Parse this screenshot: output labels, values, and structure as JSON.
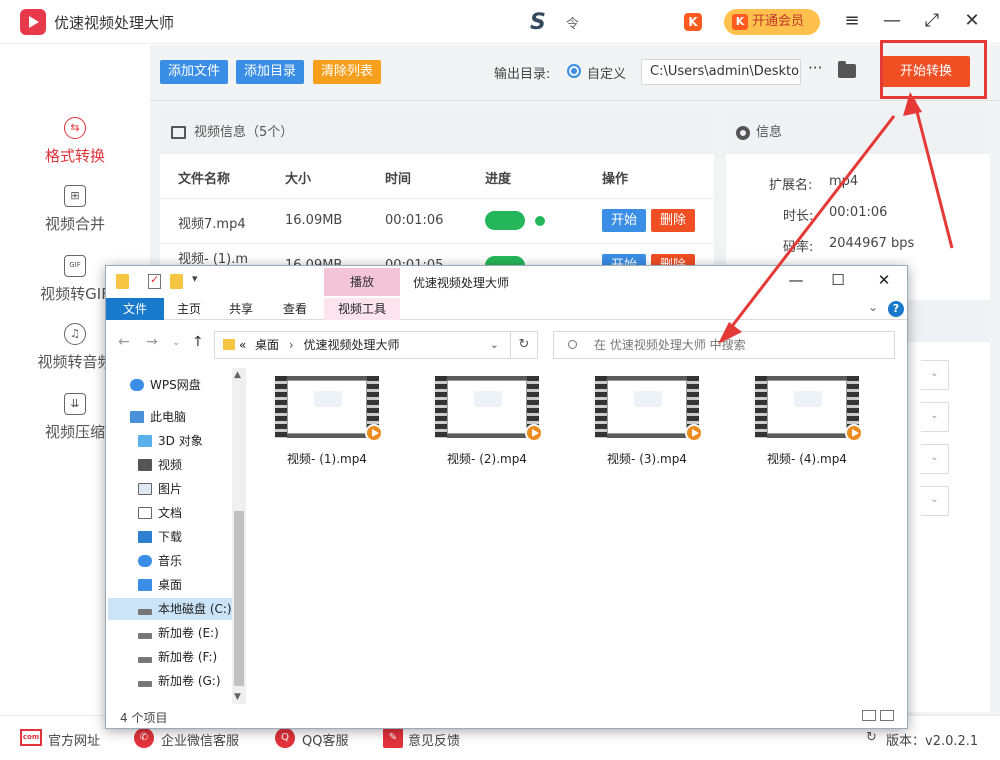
{
  "app": {
    "title": "优速视频处理大师",
    "vip_label": "开通会员",
    "brand_mark": "S",
    "cloud": "令"
  },
  "window_controls": {
    "menu": "≡",
    "minimize": "—",
    "maximize": "⤢",
    "close": "✕"
  },
  "sidebar": {
    "items": [
      {
        "label": "格式转换",
        "icon": "format-convert-icon",
        "active": true
      },
      {
        "label": "视频合并",
        "icon": "merge-icon"
      },
      {
        "label": "视频转GIF",
        "icon": "gif-icon"
      },
      {
        "label": "视频转音频",
        "icon": "audio-icon"
      },
      {
        "label": "视频压缩",
        "icon": "compress-icon"
      }
    ]
  },
  "toolbar": {
    "add_file": "添加文件",
    "add_dir": "添加目录",
    "clear_list": "清除列表",
    "output_label": "输出目录:",
    "radio_label": "自定义",
    "output_path": "C:\\Users\\admin\\Deskto",
    "more": "···",
    "start": "开始转换"
  },
  "video_panel": {
    "title": "视频信息（5个）",
    "columns": [
      "文件名称",
      "大小",
      "时间",
      "进度",
      "操作"
    ],
    "rows": [
      {
        "name": "视频7.mp4",
        "size": "16.09MB",
        "time": "00:01:06",
        "start": "开始",
        "delete": "删除"
      },
      {
        "name": "视频- (1).m",
        "size": "16.09MB",
        "time": "00:01:05",
        "start": "开始",
        "delete": "删除"
      }
    ]
  },
  "info_panel": {
    "title": "信息",
    "ext_label": "扩展名:",
    "ext_value": "mp4",
    "dur_label": "时长:",
    "dur_value": "00:01:06",
    "rate_label": "码率:",
    "rate_value": "2044967 bps"
  },
  "footer": {
    "website": "官方网址",
    "wechat": "企业微信客服",
    "qq": "QQ客服",
    "feedback": "意见反馈",
    "version": "版本：v2.0.2.1"
  },
  "explorer": {
    "tab_play": "播放",
    "title": "优速视频处理大师",
    "tabs": {
      "file": "文件",
      "home": "主页",
      "share": "共享",
      "view": "查看",
      "video_tools": "视频工具"
    },
    "breadcrumb": {
      "prefix": "«",
      "desktop": "桌面",
      "folder": "优速视频处理大师"
    },
    "search_placeholder": "在 优速视频处理大师 中搜索",
    "nav": [
      {
        "label": "WPS网盘",
        "icon": "cloud-icon"
      },
      {
        "label": "此电脑",
        "icon": "computer-icon"
      },
      {
        "label": "3D 对象",
        "icon": "3d-objects-icon"
      },
      {
        "label": "视频",
        "icon": "videos-icon"
      },
      {
        "label": "图片",
        "icon": "pictures-icon"
      },
      {
        "label": "文档",
        "icon": "documents-icon"
      },
      {
        "label": "下载",
        "icon": "downloads-icon"
      },
      {
        "label": "音乐",
        "icon": "music-icon"
      },
      {
        "label": "桌面",
        "icon": "desktop-icon"
      },
      {
        "label": "本地磁盘 (C:)",
        "icon": "drive-icon"
      },
      {
        "label": "新加卷 (E:)",
        "icon": "drive-icon"
      },
      {
        "label": "新加卷 (F:)",
        "icon": "drive-icon"
      },
      {
        "label": "新加卷 (G:)",
        "icon": "drive-icon"
      }
    ],
    "files": [
      "视频- (1).mp4",
      "视频- (2).mp4",
      "视频- (3).mp4",
      "视频- (4).mp4"
    ],
    "status": "4 个项目"
  },
  "colors": {
    "accent": "#e2323a",
    "blue": "#3a8ee6",
    "start": "#f04e23",
    "green": "#26b65a"
  }
}
